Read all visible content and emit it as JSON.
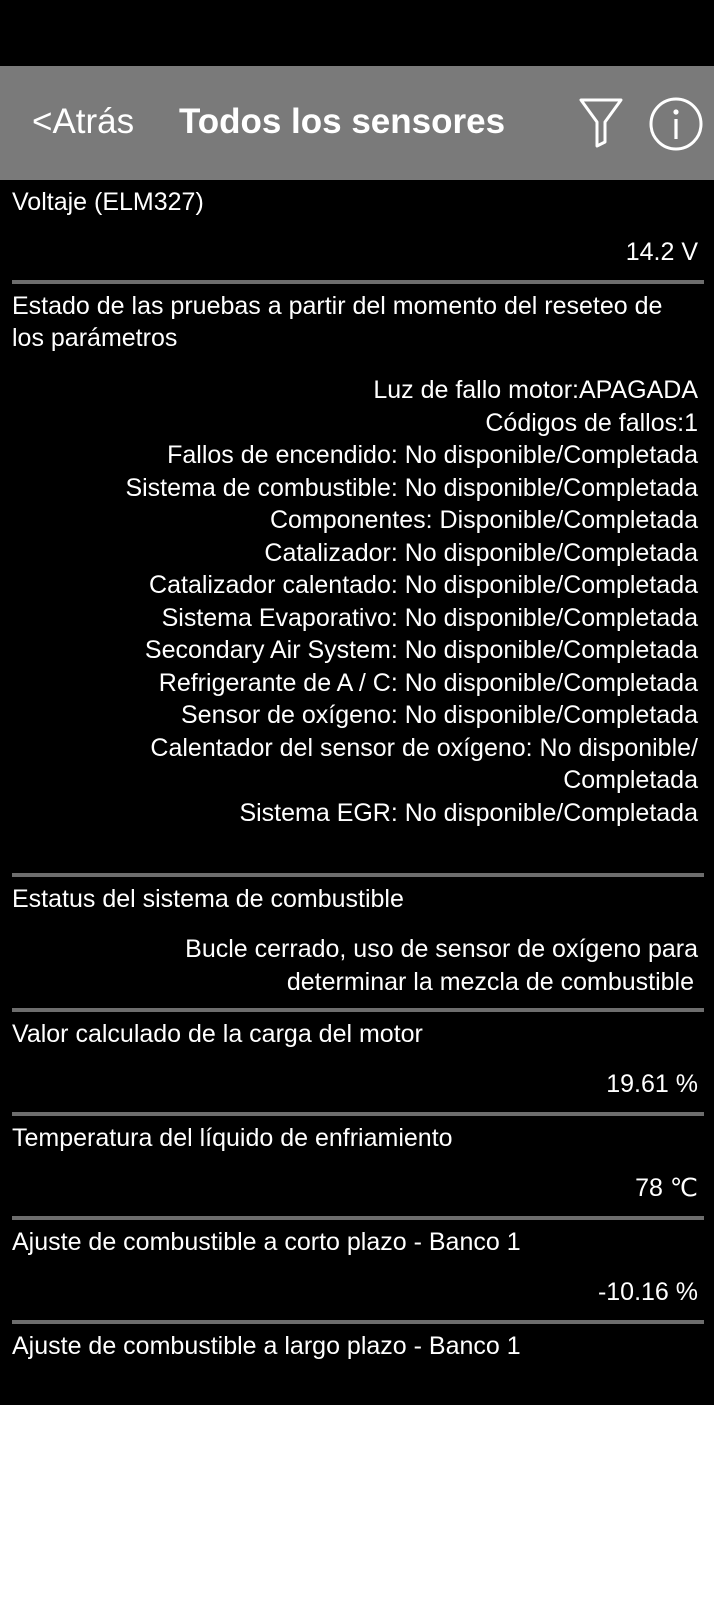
{
  "nav": {
    "back_label": "<Atrás",
    "title": "Todos los sensores"
  },
  "icons": {
    "filter": "filter-icon",
    "info": "info-icon"
  },
  "colors": {
    "nav_background": "#7a7a7a",
    "content_background": "#000000",
    "divider": "#6d6d6d",
    "text": "#ffffff"
  },
  "sensors": [
    {
      "label": "Voltaje (ELM327)",
      "value": "14.2 V"
    },
    {
      "label": "Estado de las pruebas a partir del momento del reseteo de los parámetros",
      "lines": [
        "Luz de fallo motor:APAGADA",
        "Códigos de fallos:1",
        "Fallos de encendido: No disponible/Completada",
        "Sistema de combustible: No disponible/Completada",
        "Componentes: Disponible/Completada",
        "Catalizador: No disponible/Completada",
        "Catalizador calentado: No disponible/Completada",
        "Sistema Evaporativo: No disponible/Completada",
        "Secondary Air System: No disponible/Completada",
        "Refrigerante de A / C: No disponible/Completada",
        "Sensor de oxígeno: No disponible/Completada",
        "Calentador del sensor de oxígeno: No disponible/",
        "Completada",
        "Sistema EGR: No disponible/Completada"
      ]
    },
    {
      "label": "Estatus del sistema de combustible",
      "lines": [
        "Bucle cerrado, uso de sensor de oxígeno para",
        "determinar la mezcla de combustible"
      ]
    },
    {
      "label": "Valor calculado de la carga del motor",
      "value": "19.61 %"
    },
    {
      "label": "Temperatura del líquido de enfriamiento",
      "value": "78 ℃"
    },
    {
      "label": "Ajuste de combustible a corto plazo - Banco 1",
      "value": "-10.16 %"
    },
    {
      "label": "Ajuste de combustible a largo plazo - Banco 1"
    }
  ]
}
